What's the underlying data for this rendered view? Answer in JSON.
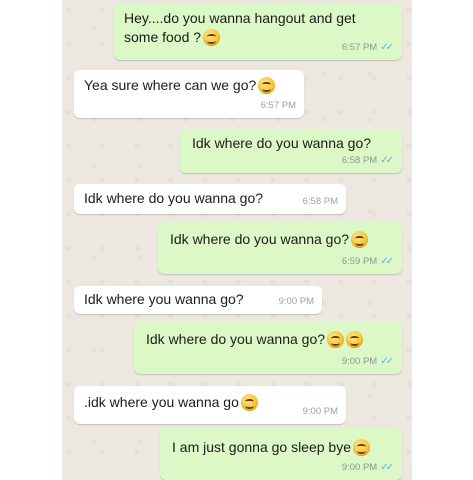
{
  "messages": [
    {
      "dir": "out",
      "text": "Hey....do you wanna hangout and get some food ?",
      "emoji": 1,
      "time": "6:57 PM",
      "read": true
    },
    {
      "dir": "in",
      "text": "Yea sure where can we go?",
      "emoji": 1,
      "time": "6:57 PM"
    },
    {
      "dir": "out",
      "text": "Idk where do you wanna go?",
      "emoji": 0,
      "time": "6:58 PM",
      "read": true
    },
    {
      "dir": "in",
      "text": "Idk where do you wanna go?",
      "emoji": 0,
      "time": "6:58 PM"
    },
    {
      "dir": "out",
      "text": "Idk where do you wanna go?",
      "emoji": 1,
      "time": "6:59 PM",
      "read": true
    },
    {
      "dir": "in",
      "text": "Idk where you wanna go?",
      "emoji": 0,
      "time": "9:00 PM"
    },
    {
      "dir": "out",
      "text": "Idk where do you wanna go?",
      "emoji": 2,
      "time": "9:00 PM",
      "read": true
    },
    {
      "dir": "in",
      "text": ".idk where you wanna go",
      "emoji": 1,
      "time": "9:00 PM"
    },
    {
      "dir": "out",
      "text": "I am just gonna go sleep bye",
      "emoji": 1,
      "time": "9:00 PM",
      "read": true
    }
  ],
  "icons": {
    "emoji": "grinning-face-icon",
    "read_receipt": "double-check-icon"
  },
  "colors": {
    "outgoing": "#dcf8c6",
    "incoming": "#ffffff",
    "tick": "#4fb6ec",
    "wallpaper": "#ece8df"
  }
}
